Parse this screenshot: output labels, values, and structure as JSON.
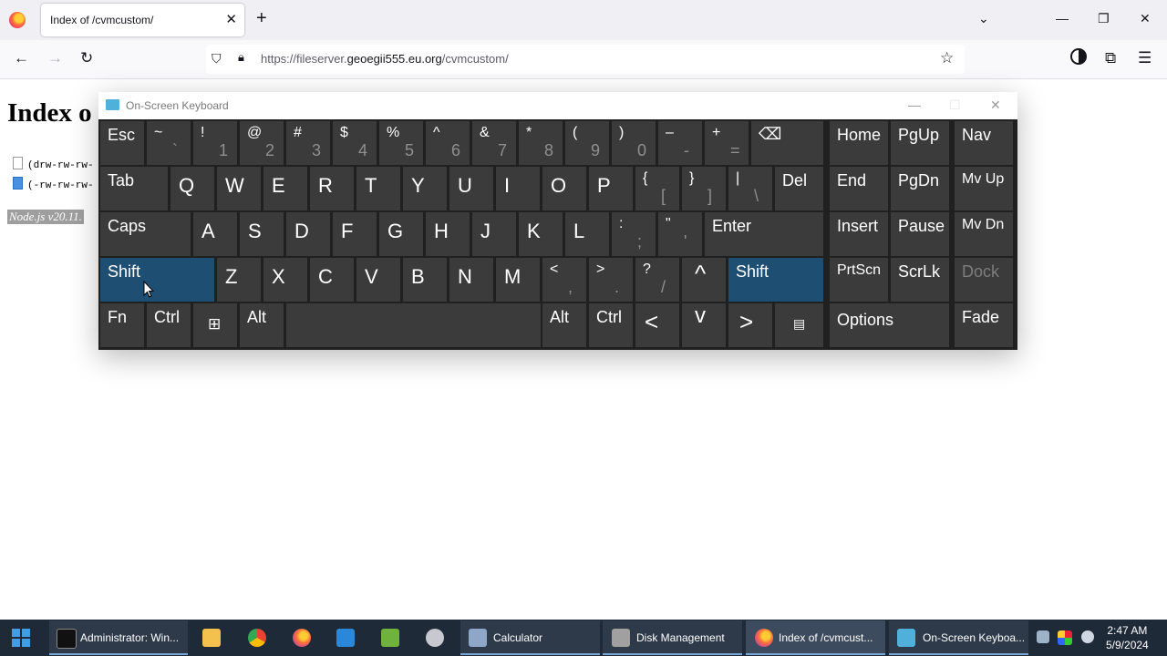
{
  "browser": {
    "tab_title": "Index of /cvmcustom/",
    "tab_close": "✕",
    "new_tab": "+",
    "tab_list": "⌄",
    "url_prefix": "https://fileserver.",
    "url_domain": "geoegii555.eu.org",
    "url_path": "/cvmcustom/"
  },
  "page": {
    "heading": "Index o",
    "rows": [
      "(drw-rw-rw-",
      "(-rw-rw-rw-"
    ],
    "footer": "Node.js v20.11."
  },
  "osk": {
    "title": "On-Screen Keyboard",
    "row1": {
      "esc": "Esc",
      "tilde_top": "~",
      "tilde_bot": "`",
      "k1_top": "!",
      "k1_bot": "1",
      "k2_top": "@",
      "k2_bot": "2",
      "k3_top": "#",
      "k3_bot": "3",
      "k4_top": "$",
      "k4_bot": "4",
      "k5_top": "%",
      "k5_bot": "5",
      "k6_top": "^",
      "k6_bot": "6",
      "k7_top": "&",
      "k7_bot": "7",
      "k8_top": "*",
      "k8_bot": "8",
      "k9_top": "(",
      "k9_bot": "9",
      "k0_top": ")",
      "k0_bot": "0",
      "minus_top": "–",
      "minus_bot": "-",
      "plus_top": "+",
      "plus_bot": "=",
      "backspace": "⌫",
      "home": "Home",
      "pgup": "PgUp",
      "nav": "Nav"
    },
    "row2": {
      "tab": "Tab",
      "q": "Q",
      "w": "W",
      "e": "E",
      "r": "R",
      "t": "T",
      "y": "Y",
      "u": "U",
      "i": "I",
      "o": "O",
      "p": "P",
      "lbrace_top": "{",
      "lbrace_bot": "[",
      "rbrace_top": "}",
      "rbrace_bot": "]",
      "pipe_top": "|",
      "pipe_bot": "\\",
      "del": "Del",
      "end": "End",
      "pgdn": "PgDn",
      "mvup": "Mv Up"
    },
    "row3": {
      "caps": "Caps",
      "a": "A",
      "s": "S",
      "d": "D",
      "f": "F",
      "g": "G",
      "h": "H",
      "j": "J",
      "k": "K",
      "l": "L",
      "colon_top": ":",
      "colon_bot": ";",
      "quote_top": "\"",
      "quote_bot": "'",
      "enter": "Enter",
      "insert": "Insert",
      "pause": "Pause",
      "mvdn": "Mv Dn"
    },
    "row4": {
      "shift_left": "Shift",
      "z": "Z",
      "x": "X",
      "c": "C",
      "v": "V",
      "b": "B",
      "n": "N",
      "m": "M",
      "lt_top": "<",
      "lt_bot": ",",
      "gt_top": ">",
      "gt_bot": ".",
      "q_top": "?",
      "q_bot": "/",
      "up": "^",
      "shift_right": "Shift",
      "prtscn": "PrtScn",
      "scrlk": "ScrLk",
      "dock": "Dock"
    },
    "row5": {
      "fn": "Fn",
      "ctrl_left": "Ctrl",
      "win": "⊞",
      "alt_left": "Alt",
      "alt_right": "Alt",
      "ctrl_right": "Ctrl",
      "left": "<",
      "down": "v",
      "right": ">",
      "menu": "▤",
      "options": "Options",
      "fade": "Fade"
    }
  },
  "taskbar": {
    "items": [
      {
        "label": "Administrator: Win...",
        "color": "#111111"
      },
      {
        "label": "Calculator",
        "color": "#8ea6c8"
      },
      {
        "label": "Disk Management",
        "color": "#a0a0a0"
      },
      {
        "label": "Index of /cvmcust...",
        "color": "#ff7139"
      },
      {
        "label": "On-Screen Keyboa...",
        "color": "#4fb0d9"
      }
    ],
    "time": "2:47 AM",
    "date": "5/9/2024"
  }
}
